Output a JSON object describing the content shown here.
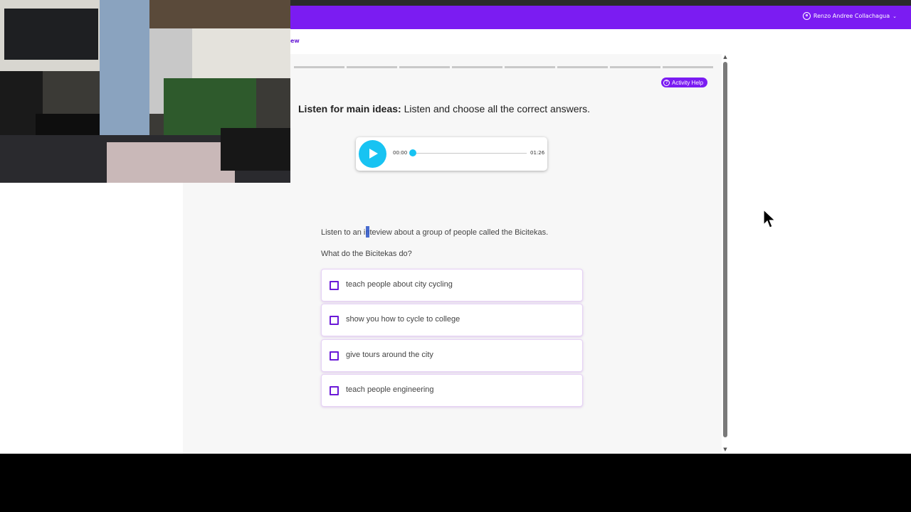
{
  "header": {
    "user_name": "Renzo Andree Collachagua",
    "brand_color": "#7b1cf2",
    "icons": [
      "user-circle-icon",
      "chevron-down-icon"
    ]
  },
  "breadcrumb": {
    "text": "ew"
  },
  "activity": {
    "help_label": "Activity Help",
    "progress_segments": 8,
    "instruction_bold": "Listen for main ideas:",
    "instruction_rest": " Listen and choose all the correct answers.",
    "audio": {
      "current_time": "00:00",
      "total_time": "01:26",
      "progress_fraction": 0.0,
      "accent_color": "#18c3f2"
    },
    "context_before": "Listen to an inte",
    "context_after": "view about a group of people called the Bicitekas.",
    "question": "What do the Bicitekas do?",
    "options": [
      {
        "label": "teach people about city cycling",
        "checked": false
      },
      {
        "label": "show you how to cycle to college",
        "checked": false
      },
      {
        "label": "give tours around the city",
        "checked": false
      },
      {
        "label": "teach people engineering",
        "checked": false
      }
    ]
  },
  "scroll": {
    "up_icon": "scroll-up-arrow-icon",
    "down_icon": "scroll-down-arrow-icon"
  }
}
